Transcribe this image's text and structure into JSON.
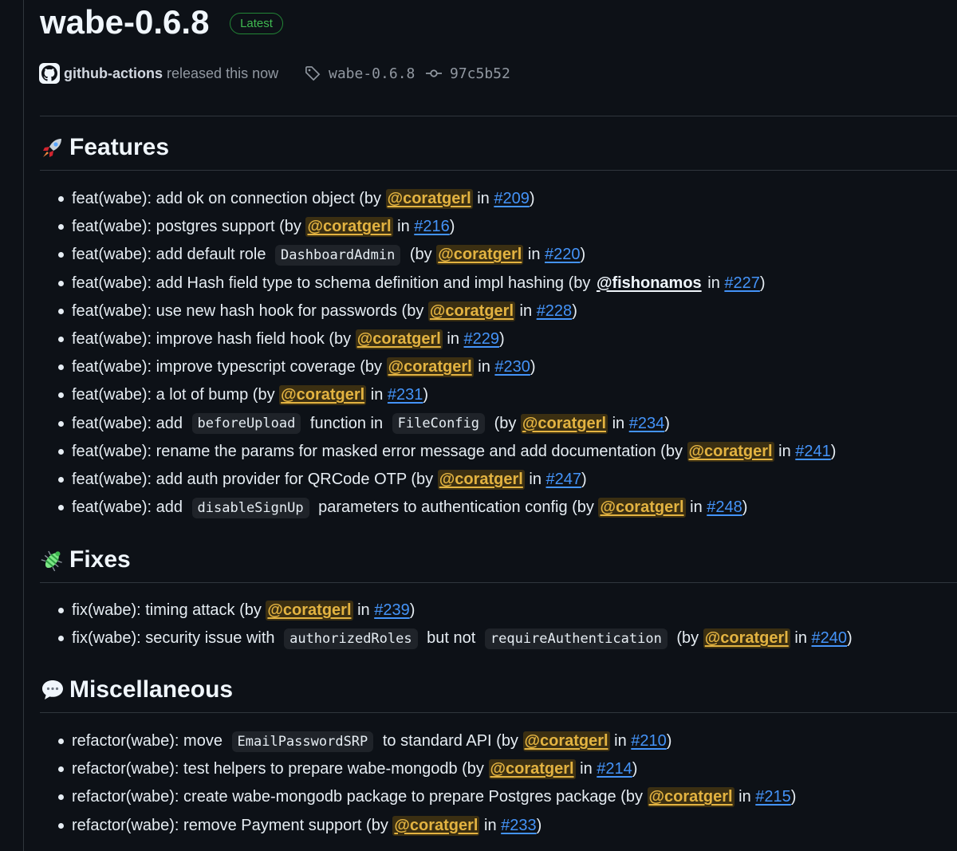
{
  "release": {
    "title": "wabe-0.6.8",
    "badge": "Latest",
    "author": "github-actions",
    "released_text": "released this now",
    "tag": "wabe-0.6.8",
    "commit": "97c5b52"
  },
  "sections": [
    {
      "title": "Features",
      "icon": "rocket-icon",
      "items": [
        {
          "text": "feat(wabe): add ok on connection object (by ",
          "user": "@coratgerl",
          "in": " in ",
          "pr": "#209",
          "end": ")"
        },
        {
          "text": "feat(wabe): postgres support (by ",
          "user": "@coratgerl",
          "in": " in ",
          "pr": "#216",
          "end": ")"
        },
        {
          "pre": "feat(wabe): add default role ",
          "code": "DashboardAdmin",
          "post": " (by ",
          "user": "@coratgerl",
          "in": " in ",
          "pr": "#220",
          "end": ")"
        },
        {
          "text": "feat(wabe): add Hash field type to schema definition and impl hashing (by ",
          "user": "@fishonamos",
          "in": " in ",
          "pr": "#227",
          "end": ")"
        },
        {
          "text": "feat(wabe): use new hash hook for passwords (by ",
          "user": "@coratgerl",
          "in": " in ",
          "pr": "#228",
          "end": ")"
        },
        {
          "text": "feat(wabe): improve hash field hook (by ",
          "user": "@coratgerl",
          "in": " in ",
          "pr": "#229",
          "end": ")"
        },
        {
          "text": "feat(wabe): improve typescript coverage (by ",
          "user": "@coratgerl",
          "in": " in ",
          "pr": "#230",
          "end": ")"
        },
        {
          "text": "feat(wabe): a lot of bump (by ",
          "user": "@coratgerl",
          "in": " in ",
          "pr": "#231",
          "end": ")"
        },
        {
          "pre": "feat(wabe): add ",
          "code": "beforeUpload",
          "mid": " function in ",
          "code2": "FileConfig",
          "post": " (by ",
          "user": "@coratgerl",
          "in": " in ",
          "pr": "#234",
          "end": ")"
        },
        {
          "text": "feat(wabe): rename the params for masked error message and add documentation (by ",
          "user": "@coratgerl",
          "in": " in ",
          "pr": "#241",
          "end": ")"
        },
        {
          "text": "feat(wabe): add auth provider for QRCode OTP (by ",
          "user": "@coratgerl",
          "in": " in ",
          "pr": "#247",
          "end": ")"
        },
        {
          "pre": "feat(wabe): add ",
          "code": "disableSignUp",
          "post": " parameters to authentication config (by ",
          "user": "@coratgerl",
          "in": " in ",
          "pr": "#248",
          "end": ")"
        }
      ]
    },
    {
      "title": "Fixes",
      "icon": "bug-icon",
      "items": [
        {
          "text": "fix(wabe): timing attack (by ",
          "user": "@coratgerl",
          "in": " in ",
          "pr": "#239",
          "end": ")"
        },
        {
          "pre": "fix(wabe): security issue with ",
          "code": "authorizedRoles",
          "mid": " but not ",
          "code2": "requireAuthentication",
          "post": " (by ",
          "user": "@coratgerl",
          "in": " in ",
          "pr": "#240",
          "end": ")"
        }
      ]
    },
    {
      "title": "Miscellaneous",
      "icon": "speech-bubble-icon",
      "items": [
        {
          "pre": "refactor(wabe): move ",
          "code": "EmailPasswordSRP",
          "post": " to standard API (by ",
          "user": "@coratgerl",
          "in": " in ",
          "pr": "#210",
          "end": ")"
        },
        {
          "text": "refactor(wabe): test helpers to prepare wabe-mongodb (by ",
          "user": "@coratgerl",
          "in": " in ",
          "pr": "#214",
          "end": ")"
        },
        {
          "text": "refactor(wabe): create wabe-mongodb package to prepare Postgres package (by ",
          "user": "@coratgerl",
          "in": " in ",
          "pr": "#215",
          "end": ")"
        },
        {
          "text": "refactor(wabe): remove Payment support (by ",
          "user": "@coratgerl",
          "in": " in ",
          "pr": "#233",
          "end": ")"
        }
      ]
    }
  ]
}
